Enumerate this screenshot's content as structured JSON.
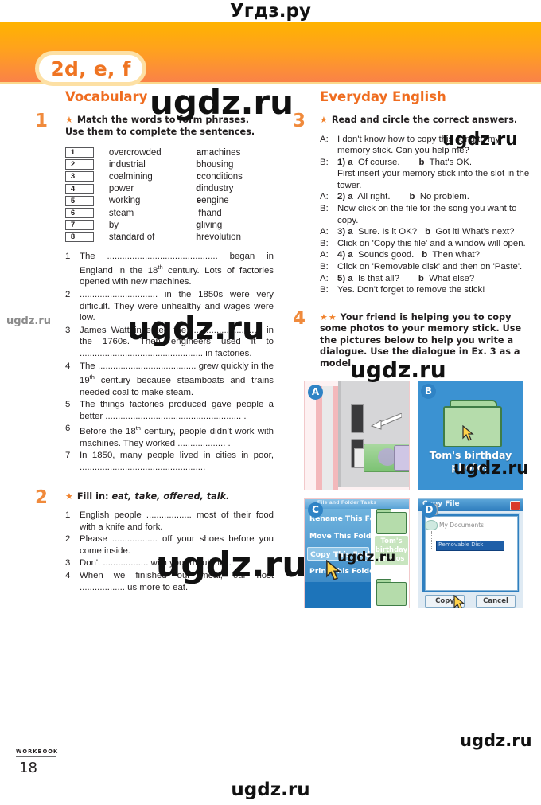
{
  "watermarks": {
    "top": "Угдз.ру",
    "bottom": "ugdz.ru",
    "big1": "ugdz.ru",
    "big2": "ugdz.ru",
    "big3": "ugdz.ru",
    "big4": "ugdz.ru",
    "big5": "ugdz.ru",
    "big6": "ugdz.ru",
    "small1": "ugdz.ru",
    "small2": "ugdz.ru",
    "small3": "ugdz.ru"
  },
  "unit_tab": {
    "main": "2d",
    "rest": ", e, f"
  },
  "left_column": {
    "title": "Vocabulary",
    "exercise1": {
      "number": "1",
      "stars": "★",
      "head_line1": "Match the words to form phrases.",
      "head_line2": "Use them to complete the sentences.",
      "pairs_left": [
        {
          "num": "1",
          "word": "overcrowded"
        },
        {
          "num": "2",
          "word": "industrial"
        },
        {
          "num": "3",
          "word": "coalmining"
        },
        {
          "num": "4",
          "word": "power"
        },
        {
          "num": "5",
          "word": "working"
        },
        {
          "num": "6",
          "word": "steam"
        },
        {
          "num": "7",
          "word": "by"
        },
        {
          "num": "8",
          "word": "standard of"
        }
      ],
      "pairs_right": [
        {
          "letter": "a",
          "word": "machines"
        },
        {
          "letter": "b",
          "word": "housing"
        },
        {
          "letter": "c",
          "word": "conditions"
        },
        {
          "letter": "d",
          "word": "industry"
        },
        {
          "letter": "e",
          "word": "engine"
        },
        {
          "letter": "f",
          "word": "hand"
        },
        {
          "letter": "g",
          "word": "living"
        },
        {
          "letter": "h",
          "word": "revolution"
        }
      ],
      "sentences": [
        {
          "num": "1",
          "text": "The ............................................ began in England in the 18th century. Lots of factories opened with new machines."
        },
        {
          "num": "2",
          "text": "............................... in the 1850s were very difficult. They were unhealthy and wages were low."
        },
        {
          "num": "3",
          "text": "James Watt invented the ............................ in the 1760s. Then engineers used it to ................................................. in factories."
        },
        {
          "num": "4",
          "text": "The ....................................... grew quickly in the 19th century because steamboats and trains needed coal to make steam."
        },
        {
          "num": "5",
          "text": "The things factories produced gave people a better ...................................................... ."
        },
        {
          "num": "6",
          "text": "Before the 18th century, people didn't work with machines. They worked ................... ."
        },
        {
          "num": "7",
          "text": "In 1850, many people lived in cities in poor, .................................................."
        }
      ]
    },
    "exercise2": {
      "number": "2",
      "stars": "★",
      "head_prefix": "Fill in:",
      "head_words": "eat, take, offered, talk.",
      "sentences": [
        {
          "num": "1",
          "text": "English people .................. most of their food with a knife and fork."
        },
        {
          "num": "2",
          "text": "Please .................. off your shoes before you come inside."
        },
        {
          "num": "3",
          "text": "Don't .................. with your mouth full."
        },
        {
          "num": "4",
          "text": "When we finished our meal, our host .................. us more to eat."
        }
      ]
    }
  },
  "right_column": {
    "title": "Everyday English",
    "exercise3": {
      "number": "3",
      "stars": "★",
      "head_line1": "Read and circle the correct answers.",
      "dialogue": [
        {
          "speaker": "A:",
          "text": "I don't know how to copy this song to my memory stick. Can you help me?"
        },
        {
          "speaker": "B:",
          "bold": "1) a",
          "opt_a": "Of course.",
          "opt_b_label": "b",
          "opt_b": "That's OK.",
          "after": "First insert your memory stick into the slot in the tower."
        },
        {
          "speaker": "A:",
          "bold": "2) a",
          "opt_a": "All right.",
          "opt_b_label": "b",
          "opt_b": "No problem.",
          "after": ""
        },
        {
          "speaker": "B:",
          "text": "Now click on the file for the song you want to copy."
        },
        {
          "speaker": "A:",
          "bold": "3) a",
          "opt_a": "Sure. Is it OK?",
          "opt_b_label": "b",
          "opt_b": "Got it! What's next?",
          "after": ""
        },
        {
          "speaker": "B:",
          "text": "Click on 'Copy this file' and a window will open."
        },
        {
          "speaker": "A:",
          "bold": "4) a",
          "opt_a": "Sounds good.",
          "opt_b_label": "b",
          "opt_b": "Then what?",
          "after": ""
        },
        {
          "speaker": "B:",
          "text": "Click on 'Removable disk' and then on 'Paste'."
        },
        {
          "speaker": "A:",
          "bold": "5) a",
          "opt_a": "Is that all?",
          "opt_b_label": "b",
          "opt_b": "What else?",
          "after": ""
        },
        {
          "speaker": "B:",
          "text": "Yes. Don't forget to remove the stick!"
        }
      ]
    },
    "exercise4": {
      "number": "4",
      "stars": "★★",
      "head": "Your friend is helping you to copy some photos to your memory stick. Use the pictures below to help you write a dialogue. Use the dialogue in Ex. 3 as a model.",
      "pictures": [
        {
          "label": "A",
          "caption": ""
        },
        {
          "label": "B",
          "caption": "Tom's birthday photos"
        },
        {
          "label": "C",
          "caption": "Tom's birthday photos",
          "menu": [
            "Rename This Folder",
            "Move This Folder",
            "Copy This Folder",
            "Print This Folder"
          ],
          "selected": "Copy This Folder",
          "titlebar": "File and Folder Tasks"
        },
        {
          "label": "D",
          "titlebar": "Copy File",
          "items": [
            "My Documents",
            "Removable Disk"
          ],
          "selected": "Removable Disk",
          "buttons": [
            "Copy",
            "Cancel"
          ]
        }
      ]
    }
  },
  "footer": {
    "label": "WORKBOOK",
    "page": "18"
  }
}
